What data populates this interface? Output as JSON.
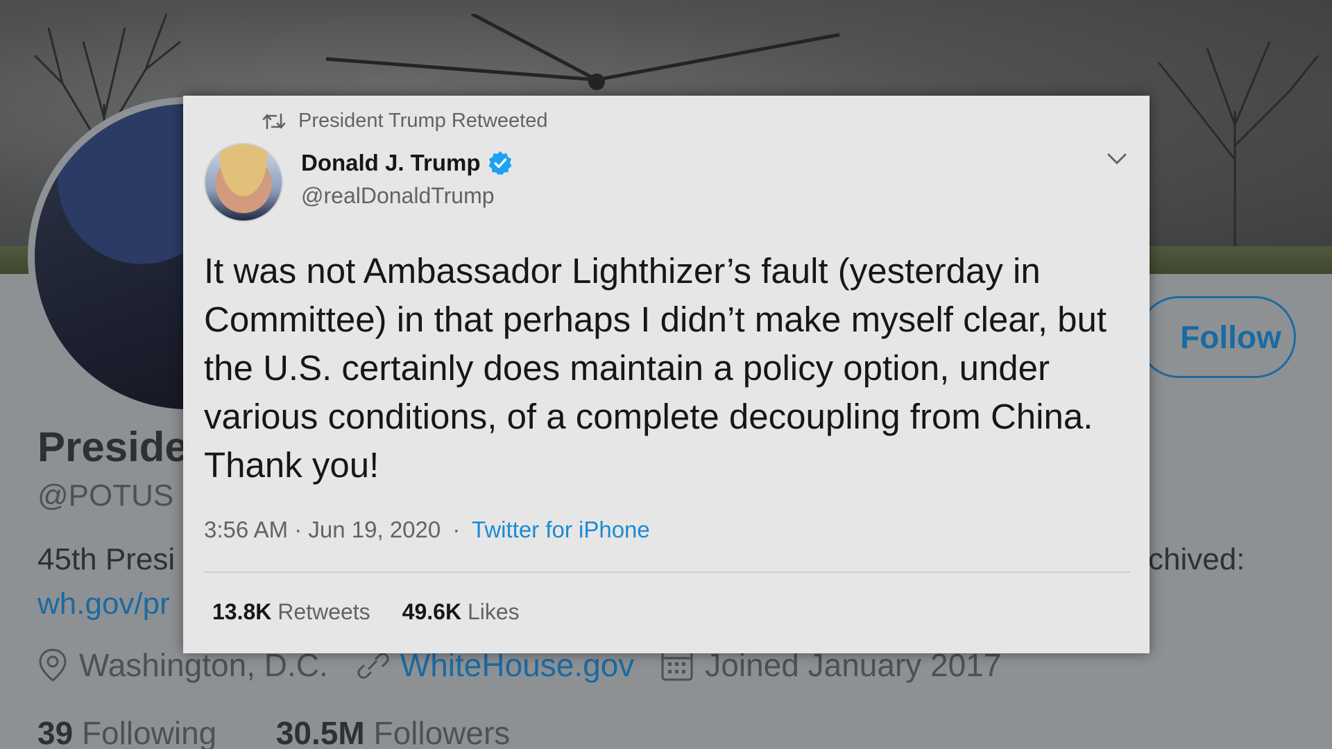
{
  "background_profile": {
    "follow_label": "Follow",
    "name_partial": "Preside",
    "handle_partial": "@POTUS",
    "bio_partial": "45th Presi",
    "bio_right_partial": "chived:",
    "link_partial": "wh.gov/pr",
    "location": "Washington, D.C.",
    "website": "WhiteHouse.gov",
    "joined": "Joined January 2017",
    "following_count": "39",
    "following_label": "Following",
    "followers_count": "30.5M",
    "followers_label": "Followers"
  },
  "tweet": {
    "retweet_context": "President Trump Retweeted",
    "author_name": "Donald J. Trump",
    "author_handle": "@realDonaldTrump",
    "text_lines": [
      "It was not Ambassador Lighthizer’s fault (yesterday in",
      "Committee) in that perhaps I didn’t make myself clear, but",
      "the U.S. certainly does maintain a policy option, under",
      "various conditions, of a complete decoupling from China.",
      "Thank you!"
    ],
    "timestamp": "3:56 AM · Jun 19, 2020",
    "separator": "·",
    "source": "Twitter for iPhone",
    "retweets_count": "13.8K",
    "retweets_label": "Retweets",
    "likes_count": "49.6K",
    "likes_label": "Likes"
  },
  "colors": {
    "accent": "#1b8ad3",
    "verified": "#1da1f2",
    "card_bg": "#e6e6e6"
  },
  "icons": [
    "retweet-icon",
    "verified-badge-icon",
    "chevron-down-icon",
    "location-icon",
    "link-icon",
    "calendar-icon"
  ]
}
